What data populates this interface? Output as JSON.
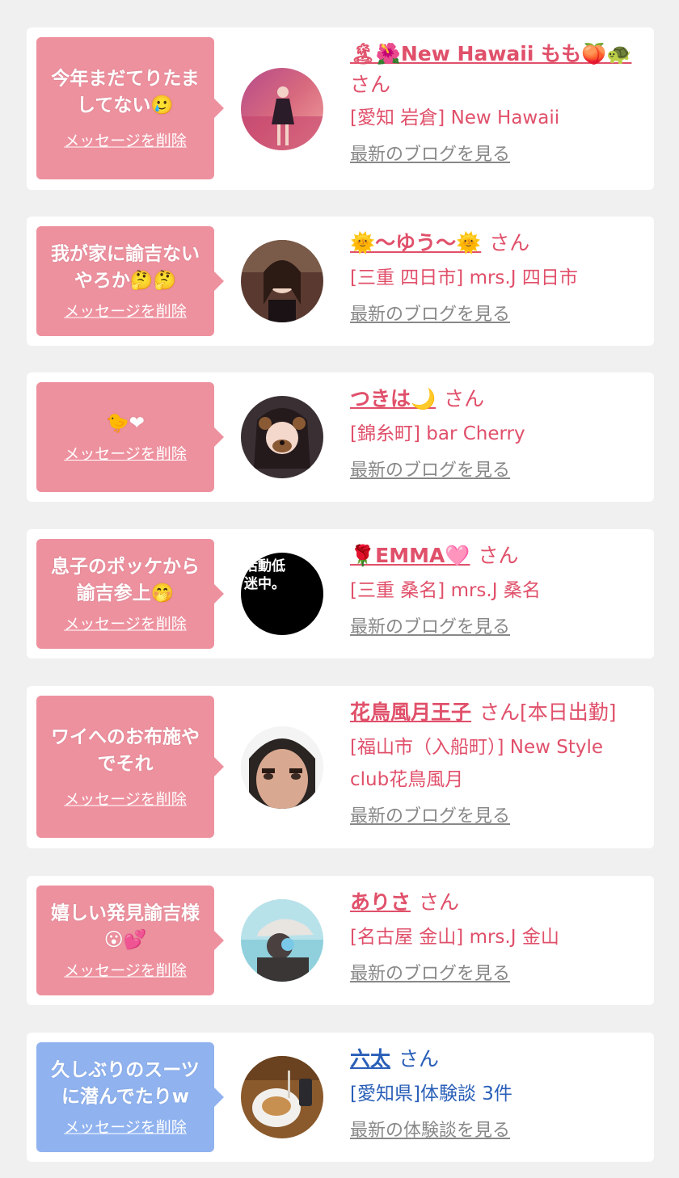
{
  "colors": {
    "pink_bubble": "#ee919f",
    "blue_bubble": "#90b3f0",
    "pink_text": "#e0506a",
    "blue_text": "#2a5fb8",
    "link_gray": "#888888"
  },
  "cards": [
    {
      "message_lines": [
        "今年まだてりたま",
        "してない🥲"
      ],
      "delete_label": "メッセージを削除",
      "name": "🏝🌺New Hawaii もも🍑🐢",
      "san": "さん",
      "shop": "[愛知 岩倉] New Hawaii",
      "blog_link": "最新のブログを見る"
    },
    {
      "message_lines": [
        "我が家に諭吉ない",
        "やろか🤔🤔"
      ],
      "delete_label": "メッセージを削除",
      "name": "🌞〜ゆう〜🌞",
      "san": "さん",
      "shop": "[三重 四日市] mrs.J 四日市",
      "blog_link": "最新のブログを見る"
    },
    {
      "message_lines": [
        "🐤❤"
      ],
      "delete_label": "メッセージを削除",
      "name": "つきは🌙",
      "san": "さん",
      "shop": "[錦糸町] bar Cherry",
      "blog_link": "最新のブログを見る"
    },
    {
      "message_lines": [
        "息子のポッケから",
        "諭吉参上🤭"
      ],
      "delete_label": "メッセージを削除",
      "name": "🌹EMMA🩷",
      "san": "さん",
      "shop": "[三重 桑名] mrs.J 桑名",
      "blog_link": "最新のブログを見る",
      "avatar_text": "活動低迷中。"
    },
    {
      "message_lines": [
        "ワイへのお布施や",
        "でそれ"
      ],
      "delete_label": "メッセージを削除",
      "name": "花鳥風月王子",
      "san": "さん[本日出勤]",
      "shop_lines": [
        "[福山市（入船町）] New Style",
        "club花鳥風月"
      ],
      "blog_link": "最新のブログを見る"
    },
    {
      "message_lines": [
        "嬉しい発見諭吉様",
        "😮💕"
      ],
      "delete_label": "メッセージを削除",
      "name": "ありさ",
      "san": "さん",
      "shop": "[名古屋 金山] mrs.J 金山",
      "blog_link": "最新のブログを見る"
    },
    {
      "message_lines": [
        "久しぶりのスーツ",
        "に潜んでたりw"
      ],
      "delete_label": "メッセージを削除",
      "name": "六太",
      "san": "さん",
      "shop": "[愛知県]体験談 3件",
      "blog_link": "最新の体験談を見る"
    }
  ]
}
